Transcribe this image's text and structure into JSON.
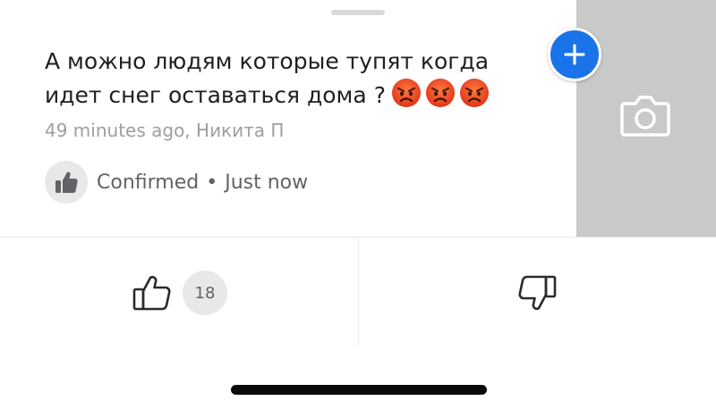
{
  "post": {
    "text": "А можно людям которые тупят когда идет снег оставаться дома ?",
    "emojis": [
      "angry-face",
      "angry-face",
      "angry-face"
    ],
    "meta": "49 minutes ago, Никита П"
  },
  "status": {
    "label": "Confirmed",
    "separator": "•",
    "time": "Just now"
  },
  "actions": {
    "upvote_count": "18"
  },
  "colors": {
    "accent": "#1a73e8",
    "side_panel": "#c9c9c9",
    "muted_text": "#9e9e9e",
    "badge_bg": "#e8e8e8"
  },
  "icons": {
    "add": "plus-icon",
    "camera": "camera-icon",
    "confirmed": "thumbs-up-filled-icon",
    "upvote": "thumbs-up-outline-icon",
    "downvote": "thumbs-down-outline-icon"
  }
}
